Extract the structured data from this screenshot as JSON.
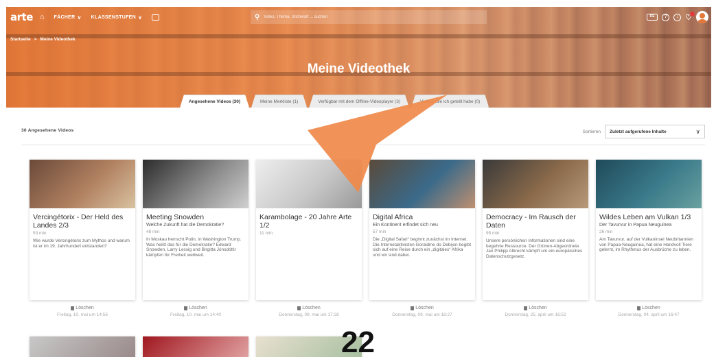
{
  "header": {
    "logo": "arte",
    "nav": [
      {
        "label": "FÄCHER"
      },
      {
        "label": "KLASSENSTUFEN"
      }
    ],
    "search_placeholder": "Video, Thema, Stichwort ... suchen",
    "right_badge": "DE"
  },
  "breadcrumb": {
    "home": "Startseite",
    "sep": ">",
    "current": "Meine Videothek"
  },
  "page_title": "Meine Videothek",
  "tabs": [
    {
      "label": "Angesehene Videos (30)",
      "active": true
    },
    {
      "label": "Meine Merkliste (1)",
      "active": false
    },
    {
      "label": "Verfügbar mit dem Offline-Videoplayer (3)",
      "active": false
    },
    {
      "label": "Videos, die ich geteilt habe (0)",
      "active": false
    }
  ],
  "list": {
    "count_label": "30 Angesehene Videos",
    "sort_label": "Sortieren",
    "sort_value": "Zuletzt aufgerufene Inhalte"
  },
  "cards": [
    {
      "title": "Vercingétorix - Der Held des Landes 2/3",
      "subtitle": "",
      "duration": "53 min",
      "description": "Wie wurde Vercingétorix zum Mythos und warum ist er im 19. Jahrhundert entstanden?",
      "delete": "Löschen",
      "date": "Freitag, 10. mai um 14:56",
      "thumb_colors": [
        "#6b4a3a",
        "#b08060",
        "#d9c2a0"
      ]
    },
    {
      "title": "Meeting Snowden",
      "subtitle": "Welche Zukunft hat die Demokratie?",
      "duration": "48 min",
      "description": "In Moskau herrscht Putin, in Washington Trump. Was heißt das für die Demokratie? Edward Snowden, Larry Lessig und Birgitta Jónsdóttir kämpfen für Freiheit weltweit.",
      "delete": "Löschen",
      "date": "Freitag, 10. mai um 14:40",
      "thumb_colors": [
        "#2c2c2c",
        "#8a8a8a",
        "#d0d0d0"
      ]
    },
    {
      "title": "Karambolage - 20 Jahre Arte 1/2",
      "subtitle": "",
      "duration": "11 min",
      "description": "",
      "delete": "Löschen",
      "date": "Donnerstag, 09. mai um 17:28",
      "thumb_colors": [
        "#eeeeee",
        "#c8c8c8",
        "#999999"
      ]
    },
    {
      "title": "Digital Africa",
      "subtitle": "Ein Kontinent erfindet sich neu",
      "duration": "57 min",
      "description": "Die „Digital Safari“ beginnt zunächst im Internet. Die Internetaktivisten Goraldine do Debijon begibt sich auf eine Reise durch ein „digitales“ Afrika und wir sind dabei.",
      "delete": "Löschen",
      "date": "Donnerstag, 09. mai um 16:27",
      "thumb_colors": [
        "#5a4a3a",
        "#3a6a8a",
        "#c09070"
      ]
    },
    {
      "title": "Democracy - Im Rausch der Daten",
      "subtitle": "",
      "duration": "95 min",
      "description": "Unsere persönlichen Informationen sind eine begehrte Ressource. Der Grünen-Abgeordnete Jan Philipp Albrecht kämpft um ein europäisches Datenschutzgesetz.",
      "delete": "Löschen",
      "date": "Donnerstag, 25. april um 16:52",
      "thumb_colors": [
        "#3a3a3a",
        "#8a6a4a",
        "#b89a7a"
      ]
    },
    {
      "title": "Wildes Leben am Vulkan 1/3",
      "subtitle": "Der Tavurvur in Papua Neuguinea",
      "duration": "26 min",
      "description": "Am Tavurvur, auf der Vulkaninsel Neubritannien von Papua-Neuguinea, hat eine Handvoll Tiere gelernt, im Rhythmus der Ausbrüche zu leben.",
      "delete": "Löschen",
      "date": "Donnerstag, 04. april um 16:47",
      "thumb_colors": [
        "#1f4a5a",
        "#3a7a8a",
        "#6aa0a0"
      ]
    }
  ],
  "row2": [
    {
      "thumb_colors": [
        "#c8c8c8",
        "#9a8a8a"
      ]
    },
    {
      "thumb_colors": [
        "#a01820",
        "#e0a0a0"
      ]
    },
    {
      "thumb_colors": [
        "#e8e0d0",
        "#a8c0a0"
      ]
    }
  ],
  "overlay": {
    "number": "22"
  }
}
